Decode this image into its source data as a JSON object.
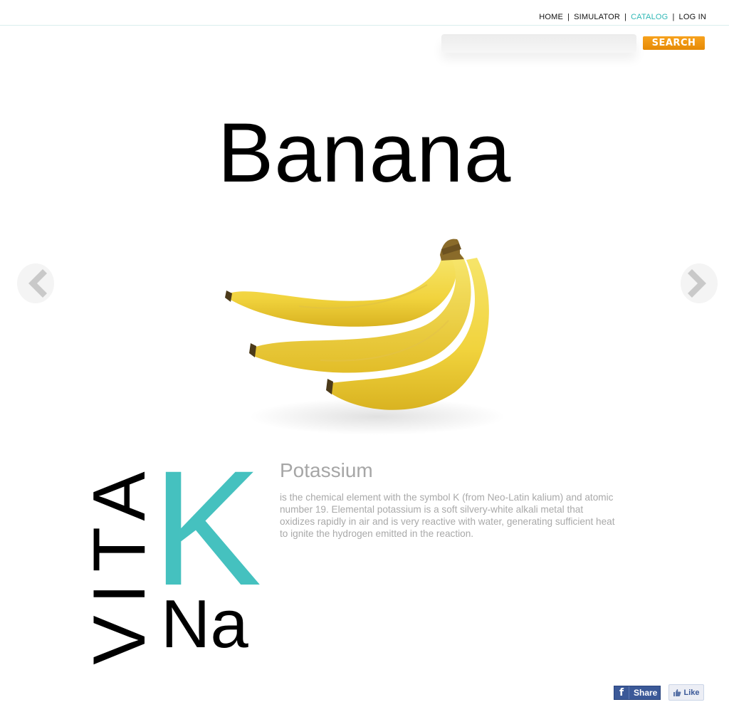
{
  "nav": {
    "items": [
      {
        "label": "HOME"
      },
      {
        "label": "SIMULATOR"
      },
      {
        "label": "CATALOG",
        "active": true
      },
      {
        "label": "LOG IN"
      }
    ],
    "separator": "|",
    "active_color": "#2fb8b6"
  },
  "search": {
    "placeholder": "",
    "button_label": "SEARCH",
    "button_color": "#f39a12"
  },
  "product": {
    "title": "Banana",
    "image": "banana-bunch"
  },
  "nutrients": {
    "vitamin_label": "VITA",
    "highlight_symbol": "K",
    "highlight_color": "#45c1bf",
    "secondary_symbol": "Na"
  },
  "element": {
    "name": "Potassium",
    "description": "is the chemical element with the symbol K (from Neo-Latin kalium) and atomic number 19. Elemental potassium is a soft silvery-white alkali metal that oxidizes rapidly in air and is very reactive with water, generating sufficient heat to ignite the hydrogen emitted in the reaction."
  },
  "social": {
    "share_label": "Share",
    "like_label": "Like",
    "share_icon": "facebook-f-icon",
    "like_icon": "thumbs-up-icon"
  },
  "carousel": {
    "prev_icon": "chevron-left-icon",
    "next_icon": "chevron-right-icon"
  }
}
